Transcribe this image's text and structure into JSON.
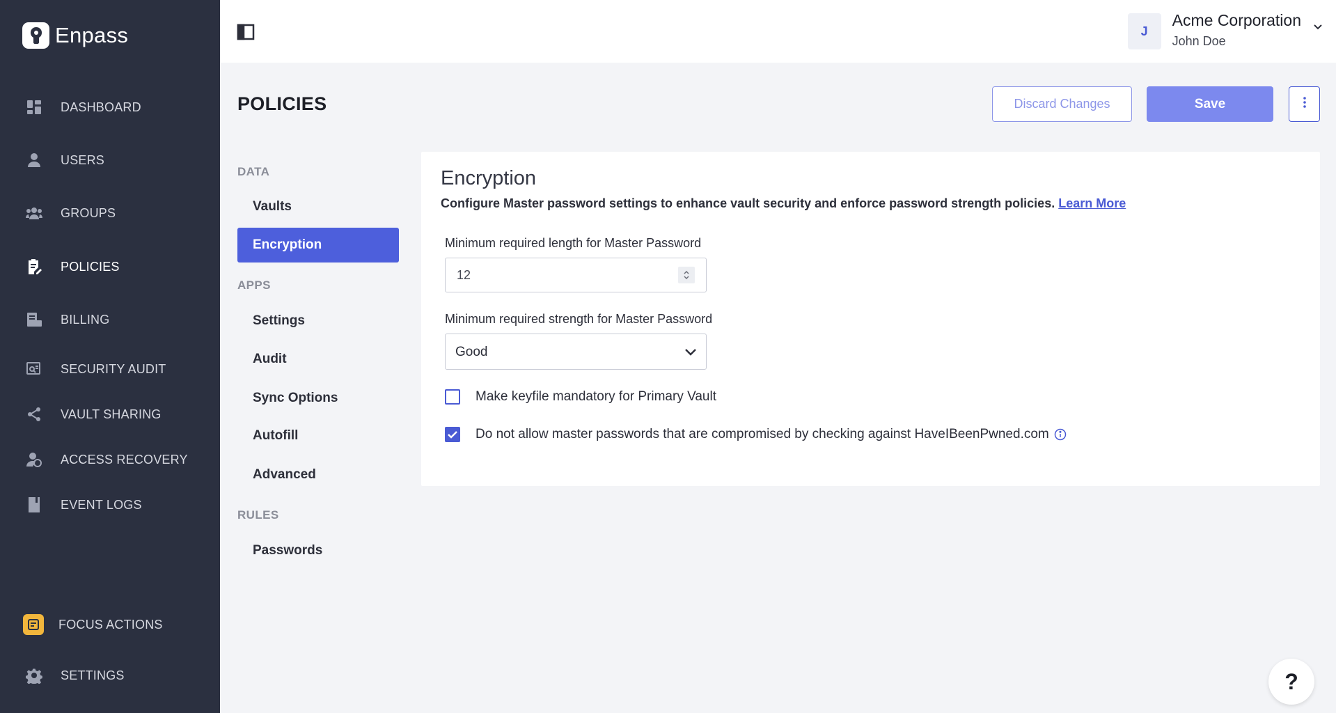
{
  "brand": {
    "name": "Enpass"
  },
  "sidebar": {
    "items": [
      {
        "label": "DASHBOARD",
        "icon": "dashboard-icon"
      },
      {
        "label": "USERS",
        "icon": "user-icon"
      },
      {
        "label": "GROUPS",
        "icon": "groups-icon"
      },
      {
        "label": "POLICIES",
        "icon": "policies-icon",
        "active": true
      },
      {
        "label": "BILLING",
        "icon": "billing-icon"
      },
      {
        "label": "SECURITY AUDIT",
        "icon": "security-audit-icon"
      },
      {
        "label": "VAULT SHARING",
        "icon": "share-icon"
      },
      {
        "label": "ACCESS RECOVERY",
        "icon": "access-recovery-icon"
      },
      {
        "label": "EVENT LOGS",
        "icon": "event-logs-icon"
      }
    ],
    "focus_actions": "FOCUS ACTIONS",
    "settings": "SETTINGS"
  },
  "topbar": {
    "avatar_initial": "J",
    "org_name": "Acme Corporation",
    "user_name": "John Doe"
  },
  "header": {
    "title": "POLICIES",
    "discard_label": "Discard Changes",
    "save_label": "Save"
  },
  "subnav": {
    "sections": [
      {
        "title": "DATA",
        "items": [
          "Vaults",
          "Encryption"
        ]
      },
      {
        "title": "APPS",
        "items": [
          "Settings",
          "Audit",
          "Sync Options",
          "Autofill",
          "Advanced"
        ]
      },
      {
        "title": "RULES",
        "items": [
          "Passwords"
        ]
      }
    ],
    "active": "Encryption"
  },
  "card": {
    "title": "Encryption",
    "description": "Configure Master password settings to enhance vault security and enforce password strength policies.",
    "learn_more": "Learn More",
    "min_length_label": "Minimum required length for Master Password",
    "min_length_value": "12",
    "min_strength_label": "Minimum required strength for Master Password",
    "min_strength_value": "Good",
    "keyfile_label": "Make keyfile mandatory for Primary Vault",
    "keyfile_checked": false,
    "hibp_label": "Do not allow master passwords that are compromised by checking against HaveIBeenPwned.com",
    "hibp_checked": true
  },
  "help": {
    "label": "?"
  },
  "colors": {
    "sidebar_bg": "#2b3040",
    "accent": "#4a5bd4",
    "save_button": "#7c89ee",
    "focus_badge": "#f2b63c"
  }
}
